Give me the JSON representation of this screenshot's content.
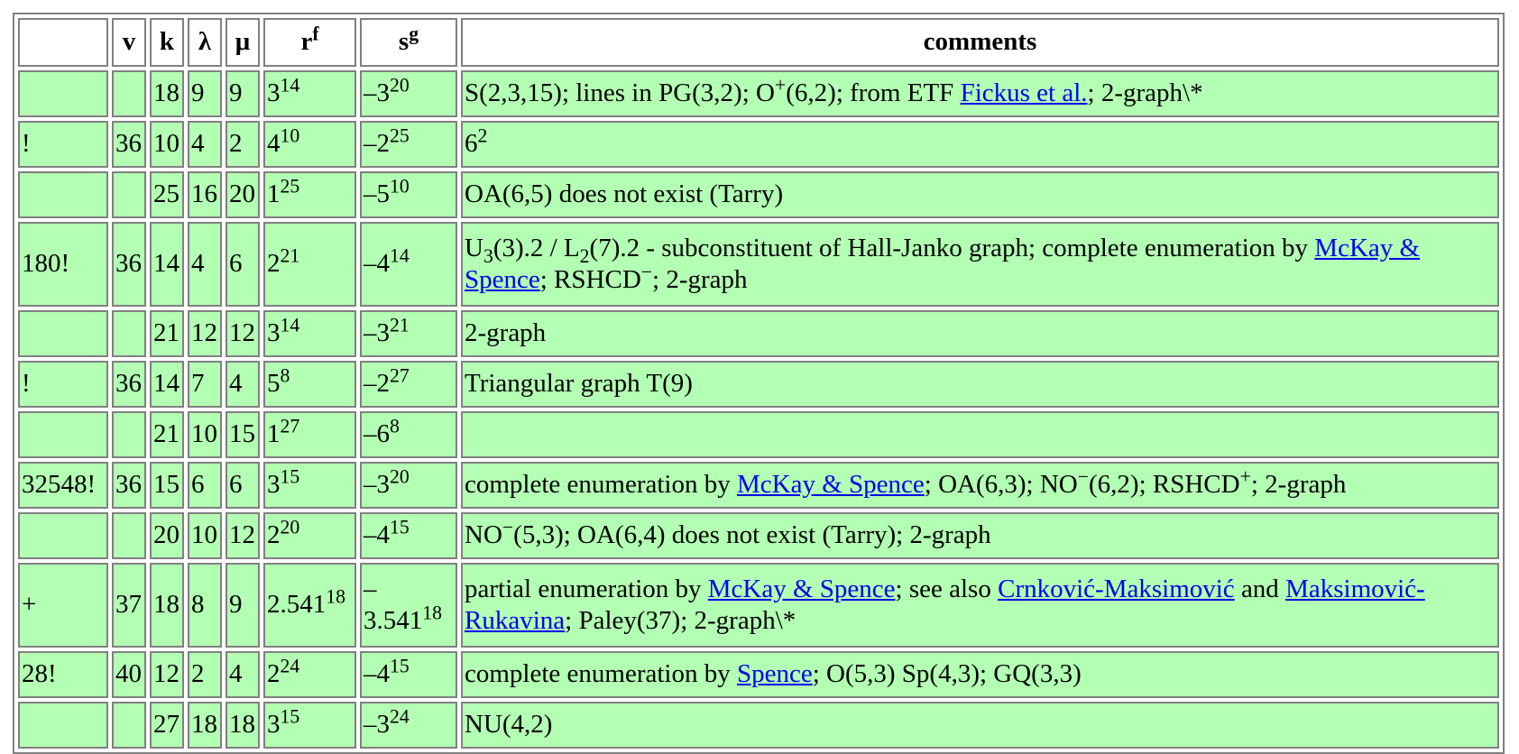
{
  "headers": {
    "v": "v",
    "k": "k",
    "lambda": "λ",
    "mu": "μ",
    "r": "r",
    "r_sup": "f",
    "s": "s",
    "s_sup": "g",
    "comments": "comments"
  },
  "rows": [
    {
      "c": "",
      "v": "",
      "k": "18",
      "l": "9",
      "m": "9",
      "r": "3",
      "rs": "14",
      "s": "–3",
      "ss": "20",
      "t0": "S(2,3,15); lines in PG(3,2); O",
      "t0s": "+",
      "t1": "(6,2); from ETF ",
      "a0": "Fickus et al.",
      "t2": "; 2-graph\\*"
    },
    {
      "c": "!",
      "v": "36",
      "k": "10",
      "l": "4",
      "m": "2",
      "r": "4",
      "rs": "10",
      "s": "–2",
      "ss": "25",
      "t0": "6",
      "t0s": "2"
    },
    {
      "c": "",
      "v": "",
      "k": "25",
      "l": "16",
      "m": "20",
      "r": "1",
      "rs": "25",
      "s": "–5",
      "ss": "10",
      "t0": "OA(6,5) does not exist (Tarry)"
    },
    {
      "c": "180!",
      "v": "36",
      "k": "14",
      "l": "4",
      "m": "6",
      "r": "2",
      "rs": "21",
      "s": "–4",
      "ss": "14",
      "t0": "U",
      "t0sub": "3",
      "t1": "(3).2 / L",
      "t1sub": "2",
      "t2": "(7).2 - subconstituent of Hall-Janko graph; complete enumeration by ",
      "a0": "McKay & Spence",
      "t3": "; RSHCD",
      "t3s": "−",
      "t4": "; 2-graph"
    },
    {
      "c": "",
      "v": "",
      "k": "21",
      "l": "12",
      "m": "12",
      "r": "3",
      "rs": "14",
      "s": "–3",
      "ss": "21",
      "t0": "2-graph"
    },
    {
      "c": "!",
      "v": "36",
      "k": "14",
      "l": "7",
      "m": "4",
      "r": "5",
      "rs": "8",
      "s": "–2",
      "ss": "27",
      "t0": "Triangular graph T(9)"
    },
    {
      "c": "",
      "v": "",
      "k": "21",
      "l": "10",
      "m": "15",
      "r": "1",
      "rs": "27",
      "s": "–6",
      "ss": "8",
      "t0": ""
    },
    {
      "c": "32548!",
      "v": "36",
      "k": "15",
      "l": "6",
      "m": "6",
      "r": "3",
      "rs": "15",
      "s": "–3",
      "ss": "20",
      "t0": "complete enumeration by ",
      "a0": "McKay & Spence",
      "t1": "; OA(6,3); NO",
      "t1s": "−",
      "t2": "(6,2); RSHCD",
      "t2s": "+",
      "t3": "; 2-graph"
    },
    {
      "c": "",
      "v": "",
      "k": "20",
      "l": "10",
      "m": "12",
      "r": "2",
      "rs": "20",
      "s": "–4",
      "ss": "15",
      "t0": "NO",
      "t0s": "−",
      "t1": "(5,3); OA(6,4) does not exist (Tarry); 2-graph"
    },
    {
      "c": "+",
      "v": "37",
      "k": "18",
      "l": "8",
      "m": "9",
      "r": "2.541",
      "rs": "18",
      "s": "–",
      "s2": "3.541",
      "ss": "18",
      "t0": "partial enumeration by ",
      "a0": "McKay & Spence",
      "t1": "; see also ",
      "a1": "Crnković-Maksimović",
      "t2": " and ",
      "a2": "Maksimović-Rukavina",
      "t3": "; Paley(37); 2-graph\\*"
    },
    {
      "c": "28!",
      "v": "40",
      "k": "12",
      "l": "2",
      "m": "4",
      "r": "2",
      "rs": "24",
      "s": "–4",
      "ss": "15",
      "t0": "complete enumeration by ",
      "a0": "Spence",
      "t1": "; O(5,3) Sp(4,3); GQ(3,3)"
    },
    {
      "c": "",
      "v": "",
      "k": "27",
      "l": "18",
      "m": "18",
      "r": "3",
      "rs": "15",
      "s": "–3",
      "ss": "24",
      "t0": "NU(4,2)"
    }
  ]
}
